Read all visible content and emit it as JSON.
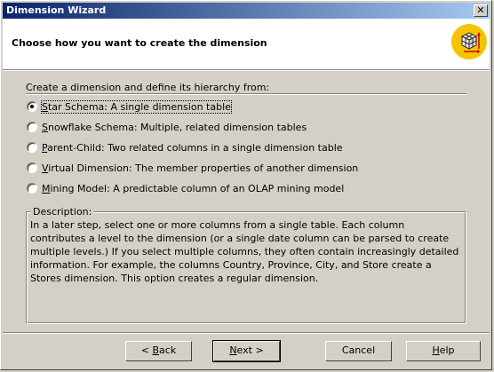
{
  "window": {
    "title": "Dimension Wizard",
    "close_glyph": "✕"
  },
  "header": {
    "heading": "Choose how you want to create the dimension",
    "icon": "cube-icon"
  },
  "prompt": "Create a dimension and define its hierarchy from:",
  "options": [
    {
      "accel": "S",
      "rest": "tar Schema: A single dimension table",
      "checked": true
    },
    {
      "accel": "S",
      "rest": "nowflake Schema: Multiple, related dimension tables",
      "checked": false
    },
    {
      "accel": "P",
      "rest": "arent-Child: Two related columns in a single dimension table",
      "checked": false
    },
    {
      "accel": "V",
      "rest": "irtual Dimension: The member properties of another dimension",
      "checked": false
    },
    {
      "accel": "M",
      "rest": "ining Model: A predictable column of an OLAP mining model",
      "checked": false
    }
  ],
  "description": {
    "label": "Description:",
    "text": "In a later step, select one or more columns from a single table. Each column contributes a level to the dimension (or a single date column can be parsed to create multiple levels.) If you select multiple columns, they often contain increasingly detailed information. For example, the columns Country, Province, City, and Store create a Stores dimension. This option creates a regular dimension."
  },
  "buttons": {
    "back": {
      "prefix": "< ",
      "accel": "B",
      "rest": "ack"
    },
    "next": {
      "accel": "N",
      "rest": "ext >"
    },
    "cancel": {
      "label": "Cancel"
    },
    "help": {
      "accel": "H",
      "rest": "elp"
    }
  }
}
